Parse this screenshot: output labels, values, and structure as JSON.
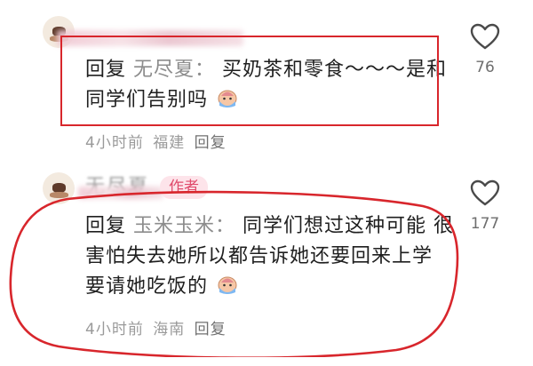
{
  "colors": {
    "annotation_red": "#d8262c",
    "author_badge_bg": "#fde4ea",
    "author_badge_text": "#e04b6c",
    "meta_gray": "#9a9a9a",
    "mention_gray": "#8c8c8c"
  },
  "comments": [
    {
      "reply_prefix": "回复",
      "mention": "无尽夏：",
      "text": "买奶茶和零食～～～是和同学们告别吗",
      "emoji": "crying-face-emoji",
      "time": "4小时前",
      "location": "福建",
      "reply_label": "回复",
      "likes": "76",
      "like_icon": "heart-outline-icon"
    },
    {
      "username": "无尽夏",
      "author_badge": "作者",
      "reply_prefix": "回复",
      "mention": "玉米玉米：",
      "text": "同学们想过这种可能 很害怕失去她所以都告诉她还要回来上学 要请她吃饭的",
      "emoji": "crying-face-emoji",
      "time": "4小时前",
      "location": "海南",
      "reply_label": "回复",
      "likes": "177",
      "like_icon": "heart-outline-icon"
    }
  ]
}
